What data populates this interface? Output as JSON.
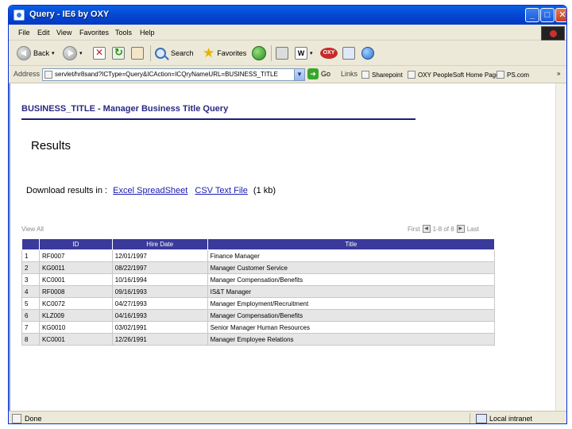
{
  "window": {
    "title": "Query - IE6 by OXY"
  },
  "menu": [
    "File",
    "Edit",
    "View",
    "Favorites",
    "Tools",
    "Help"
  ],
  "toolbar": {
    "back_label": "Back",
    "search_label": "Search",
    "favorites_label": "Favorites",
    "word_label": "W"
  },
  "address": {
    "label": "Address",
    "url": "servlet/hr8sand?ICType=Query&ICAction=ICQryNameURL=BUSINESS_TITLE",
    "go_label": "Go",
    "links_label": "Links",
    "links": [
      "Sharepoint",
      "OXY PeopleSoft Home Page",
      "PS.com"
    ],
    "more": "»"
  },
  "page": {
    "query_title": "BUSINESS_TITLE - Manager Business Title Query",
    "results_heading": "Results",
    "download_prefix": "Download results in :",
    "excel_link": "Excel SpreadSheet",
    "csv_link": "CSV Text File",
    "size": "(1 kb)",
    "view_all": "View All",
    "pager": {
      "first": "First",
      "range": "1-8 of 8",
      "last": "Last"
    }
  },
  "table": {
    "columns": [
      "",
      "ID",
      "Hire Date",
      "Title"
    ],
    "rows": [
      {
        "num": "1",
        "id": "RF0007",
        "hire_date": "12/01/1997",
        "title": "Finance Manager"
      },
      {
        "num": "2",
        "id": "KG0011",
        "hire_date": "08/22/1997",
        "title": "Manager Customer Service"
      },
      {
        "num": "3",
        "id": "KC0001",
        "hire_date": "10/16/1994",
        "title": "Manager Compensation/Benefits"
      },
      {
        "num": "4",
        "id": "RF0008",
        "hire_date": "09/16/1993",
        "title": "IS&T Manager"
      },
      {
        "num": "5",
        "id": "KC0072",
        "hire_date": "04/27/1993",
        "title": "Manager Employment/Recruitment"
      },
      {
        "num": "6",
        "id": "KLZ009",
        "hire_date": "04/16/1993",
        "title": "Manager Compensation/Benefits"
      },
      {
        "num": "7",
        "id": "KG0010",
        "hire_date": "03/02/1991",
        "title": "Senior Manager Human Resources"
      },
      {
        "num": "8",
        "id": "KC0001",
        "hire_date": "12/26/1991",
        "title": "Manager Employee Relations"
      }
    ]
  },
  "status": {
    "text": "Done",
    "zone": "Local intranet"
  }
}
